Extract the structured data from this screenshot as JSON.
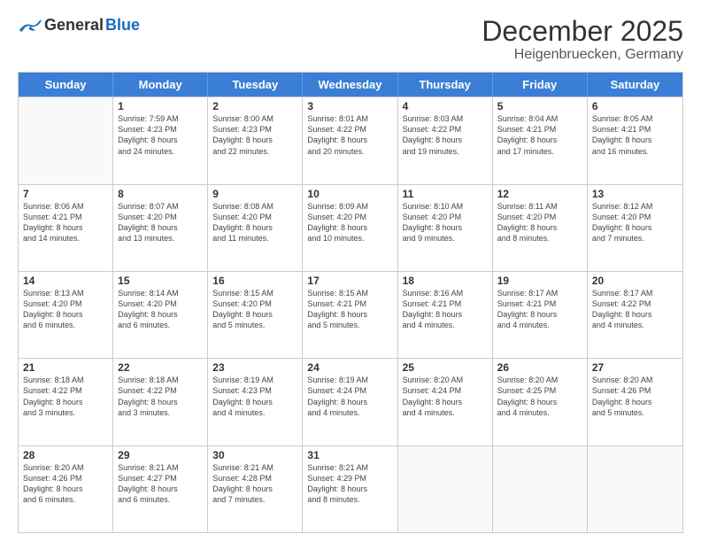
{
  "logo": {
    "general": "General",
    "blue": "Blue"
  },
  "title": "December 2025",
  "subtitle": "Heigenbruecken, Germany",
  "days": [
    "Sunday",
    "Monday",
    "Tuesday",
    "Wednesday",
    "Thursday",
    "Friday",
    "Saturday"
  ],
  "rows": [
    [
      {
        "day": "",
        "info": ""
      },
      {
        "day": "1",
        "info": "Sunrise: 7:59 AM\nSunset: 4:23 PM\nDaylight: 8 hours\nand 24 minutes."
      },
      {
        "day": "2",
        "info": "Sunrise: 8:00 AM\nSunset: 4:23 PM\nDaylight: 8 hours\nand 22 minutes."
      },
      {
        "day": "3",
        "info": "Sunrise: 8:01 AM\nSunset: 4:22 PM\nDaylight: 8 hours\nand 20 minutes."
      },
      {
        "day": "4",
        "info": "Sunrise: 8:03 AM\nSunset: 4:22 PM\nDaylight: 8 hours\nand 19 minutes."
      },
      {
        "day": "5",
        "info": "Sunrise: 8:04 AM\nSunset: 4:21 PM\nDaylight: 8 hours\nand 17 minutes."
      },
      {
        "day": "6",
        "info": "Sunrise: 8:05 AM\nSunset: 4:21 PM\nDaylight: 8 hours\nand 16 minutes."
      }
    ],
    [
      {
        "day": "7",
        "info": "Sunrise: 8:06 AM\nSunset: 4:21 PM\nDaylight: 8 hours\nand 14 minutes."
      },
      {
        "day": "8",
        "info": "Sunrise: 8:07 AM\nSunset: 4:20 PM\nDaylight: 8 hours\nand 13 minutes."
      },
      {
        "day": "9",
        "info": "Sunrise: 8:08 AM\nSunset: 4:20 PM\nDaylight: 8 hours\nand 11 minutes."
      },
      {
        "day": "10",
        "info": "Sunrise: 8:09 AM\nSunset: 4:20 PM\nDaylight: 8 hours\nand 10 minutes."
      },
      {
        "day": "11",
        "info": "Sunrise: 8:10 AM\nSunset: 4:20 PM\nDaylight: 8 hours\nand 9 minutes."
      },
      {
        "day": "12",
        "info": "Sunrise: 8:11 AM\nSunset: 4:20 PM\nDaylight: 8 hours\nand 8 minutes."
      },
      {
        "day": "13",
        "info": "Sunrise: 8:12 AM\nSunset: 4:20 PM\nDaylight: 8 hours\nand 7 minutes."
      }
    ],
    [
      {
        "day": "14",
        "info": "Sunrise: 8:13 AM\nSunset: 4:20 PM\nDaylight: 8 hours\nand 6 minutes."
      },
      {
        "day": "15",
        "info": "Sunrise: 8:14 AM\nSunset: 4:20 PM\nDaylight: 8 hours\nand 6 minutes."
      },
      {
        "day": "16",
        "info": "Sunrise: 8:15 AM\nSunset: 4:20 PM\nDaylight: 8 hours\nand 5 minutes."
      },
      {
        "day": "17",
        "info": "Sunrise: 8:15 AM\nSunset: 4:21 PM\nDaylight: 8 hours\nand 5 minutes."
      },
      {
        "day": "18",
        "info": "Sunrise: 8:16 AM\nSunset: 4:21 PM\nDaylight: 8 hours\nand 4 minutes."
      },
      {
        "day": "19",
        "info": "Sunrise: 8:17 AM\nSunset: 4:21 PM\nDaylight: 8 hours\nand 4 minutes."
      },
      {
        "day": "20",
        "info": "Sunrise: 8:17 AM\nSunset: 4:22 PM\nDaylight: 8 hours\nand 4 minutes."
      }
    ],
    [
      {
        "day": "21",
        "info": "Sunrise: 8:18 AM\nSunset: 4:22 PM\nDaylight: 8 hours\nand 3 minutes."
      },
      {
        "day": "22",
        "info": "Sunrise: 8:18 AM\nSunset: 4:22 PM\nDaylight: 8 hours\nand 3 minutes."
      },
      {
        "day": "23",
        "info": "Sunrise: 8:19 AM\nSunset: 4:23 PM\nDaylight: 8 hours\nand 4 minutes."
      },
      {
        "day": "24",
        "info": "Sunrise: 8:19 AM\nSunset: 4:24 PM\nDaylight: 8 hours\nand 4 minutes."
      },
      {
        "day": "25",
        "info": "Sunrise: 8:20 AM\nSunset: 4:24 PM\nDaylight: 8 hours\nand 4 minutes."
      },
      {
        "day": "26",
        "info": "Sunrise: 8:20 AM\nSunset: 4:25 PM\nDaylight: 8 hours\nand 4 minutes."
      },
      {
        "day": "27",
        "info": "Sunrise: 8:20 AM\nSunset: 4:26 PM\nDaylight: 8 hours\nand 5 minutes."
      }
    ],
    [
      {
        "day": "28",
        "info": "Sunrise: 8:20 AM\nSunset: 4:26 PM\nDaylight: 8 hours\nand 6 minutes."
      },
      {
        "day": "29",
        "info": "Sunrise: 8:21 AM\nSunset: 4:27 PM\nDaylight: 8 hours\nand 6 minutes."
      },
      {
        "day": "30",
        "info": "Sunrise: 8:21 AM\nSunset: 4:28 PM\nDaylight: 8 hours\nand 7 minutes."
      },
      {
        "day": "31",
        "info": "Sunrise: 8:21 AM\nSunset: 4:29 PM\nDaylight: 8 hours\nand 8 minutes."
      },
      {
        "day": "",
        "info": ""
      },
      {
        "day": "",
        "info": ""
      },
      {
        "day": "",
        "info": ""
      }
    ]
  ]
}
